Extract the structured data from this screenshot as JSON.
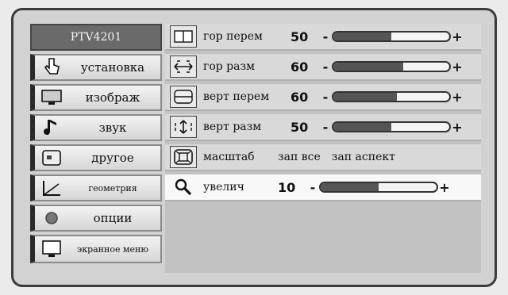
{
  "sidebar": {
    "header": "PTV4201",
    "items": [
      {
        "label": "установка",
        "icon": "hand-pointer-icon"
      },
      {
        "label": "изображ",
        "icon": "monitor-icon"
      },
      {
        "label": "звук",
        "icon": "music-note-icon"
      },
      {
        "label": "другое",
        "icon": "screen-frame-icon"
      },
      {
        "label": "геометрия",
        "icon": "geometry-angle-icon"
      },
      {
        "label": "опции",
        "icon": "options-dot-icon"
      },
      {
        "label": "экранное меню",
        "icon": "osd-screen-icon"
      }
    ]
  },
  "main": {
    "rows": [
      {
        "label": "гор перем",
        "value": "50",
        "level": 0.5,
        "icon": "horizontal-position-icon"
      },
      {
        "label": "гор разм",
        "value": "60",
        "level": 0.6,
        "icon": "horizontal-size-icon"
      },
      {
        "label": "верт перем",
        "value": "60",
        "level": 0.55,
        "icon": "vertical-position-icon"
      },
      {
        "label": "верт разм",
        "value": "50",
        "level": 0.5,
        "icon": "vertical-size-icon"
      }
    ],
    "scale_row": {
      "label": "масштаб",
      "options": [
        "зап все",
        "зап аспект"
      ],
      "icon": "scale-icon"
    },
    "zoom_row": {
      "label": "увелич",
      "value": "10",
      "level": 0.5,
      "icon": "magnifier-icon"
    },
    "minus": "-",
    "plus": "+"
  },
  "colors": {
    "header_bg": "#6a6a6a",
    "fill": "#555555",
    "highlight": "#f8f8f8"
  }
}
